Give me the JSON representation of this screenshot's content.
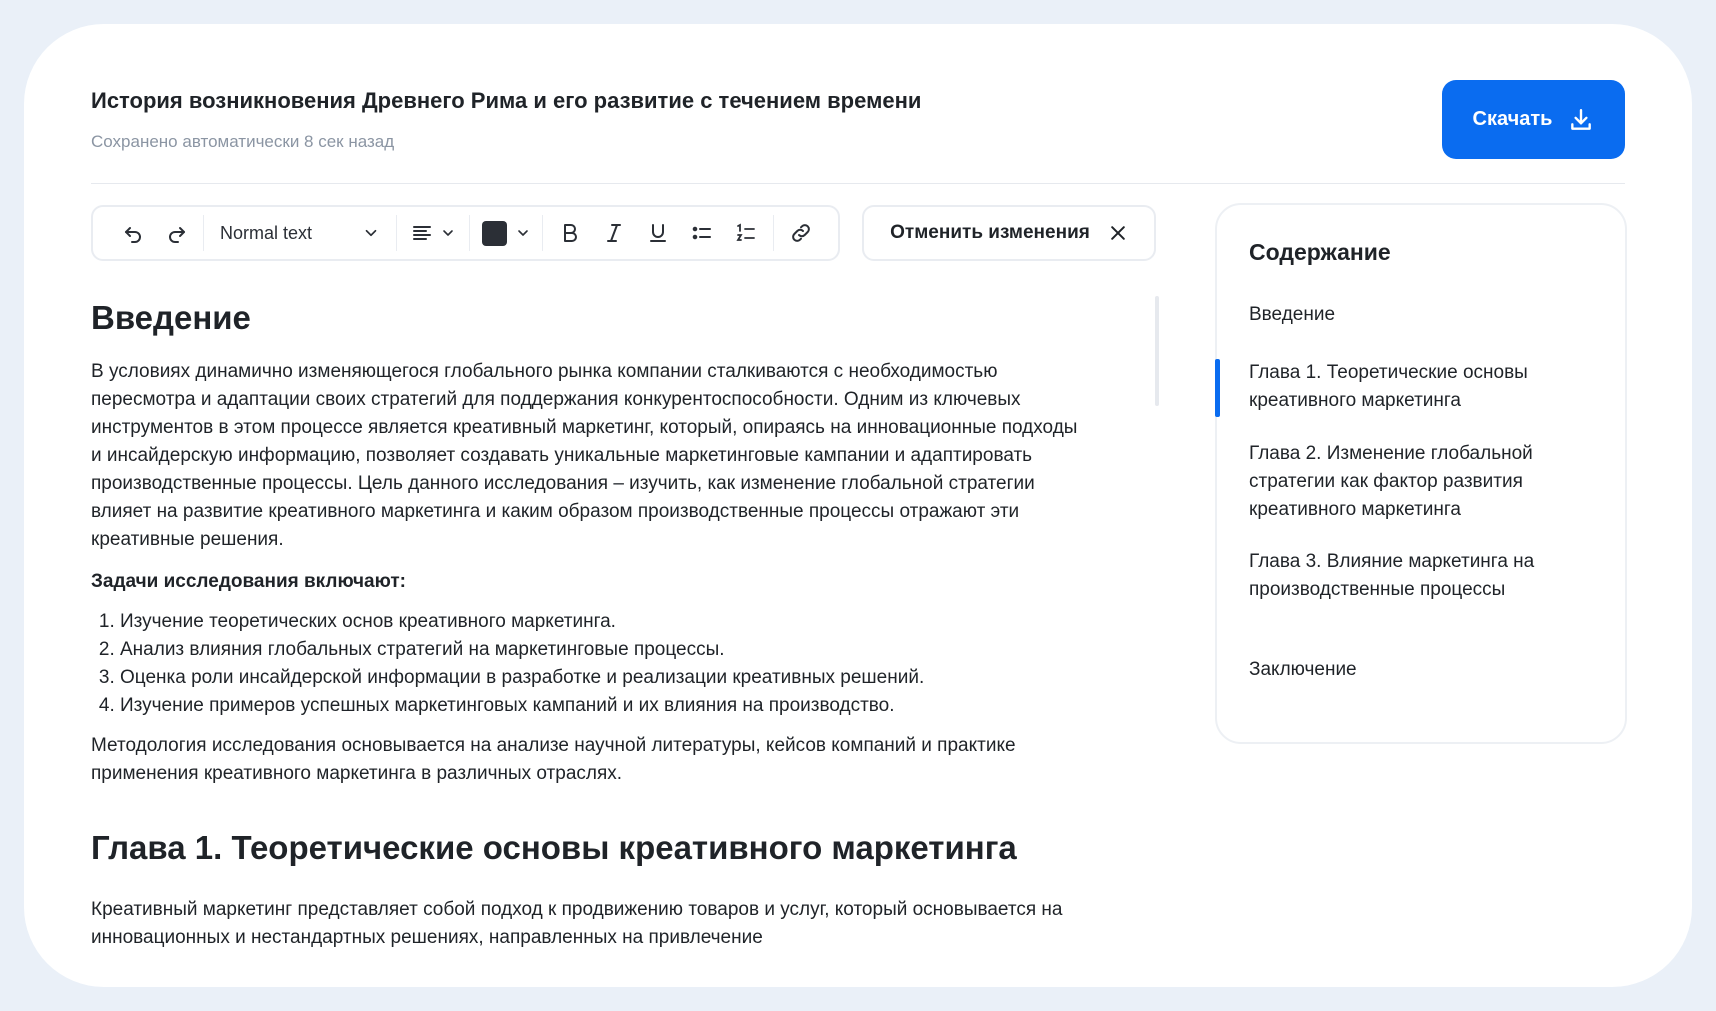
{
  "header": {
    "title": "История возникновения Древнего Рима и его развитие с течением времени",
    "saved_status": "Сохранено автоматически 8 сек назад",
    "download_label": "Скачать"
  },
  "toolbar": {
    "text_format": "Normal text",
    "text_color": "#2b2f36",
    "cancel_label": "Отменить изменения",
    "icons": [
      "undo-icon",
      "redo-icon",
      "chevron-down-icon",
      "align-left-icon",
      "bold-icon",
      "italic-icon",
      "underline-icon",
      "bullet-list-icon",
      "numbered-list-icon",
      "link-icon",
      "close-icon"
    ]
  },
  "document": {
    "intro_heading": "Введение",
    "intro_paragraph": "В условиях динамично изменяющегося глобального рынка компании сталкиваются с необходимостью пересмотра и адаптации своих стратегий для поддержания конкурентоспособности. Одним из ключевых инструментов в этом процессе является креативный маркетинг, который, опираясь на инновационные подходы и инсайдерскую информацию, позволяет создавать уникальные маркетинговые кампании и адаптировать производственные процессы. Цель данного исследования – изучить, как изменение глобальной стратегии влияет на развитие креативного маркетинга и каким образом производственные процессы отражают эти креативные решения.",
    "tasks_title": "Задачи исследования включают:",
    "tasks": [
      "Изучение теоретических основ креативного маркетинга.",
      "Анализ влияния глобальных стратегий на маркетинговые процессы.",
      "Оценка роли инсайдерской информации в разработке и реализации креативных решений.",
      "Изучение примеров успешных маркетинговых кампаний и их влияния на производство."
    ],
    "methodology": "Методология исследования основывается на анализе научной литературы, кейсов компаний и практике применения креативного маркетинга в различных отраслях.",
    "chapter1_heading": "Глава 1. Теоретические основы креативного маркетинга",
    "chapter1_paragraph": "Креативный маркетинг представляет собой подход к продвижению товаров и услуг, который основывается на инновационных и нестандартных решениях, направленных на привлечение"
  },
  "toc": {
    "title": "Содержание",
    "items": [
      "Введение",
      "Глава 1. Теоретические основы креативного маркетинга",
      "Глава 2. Изменение глобальной стратегии как фактор развития креативного маркетинга",
      "Глава 3. Влияние маркетинга на производственные процессы",
      "Заключение"
    ],
    "active_index": 1
  },
  "colors": {
    "accent": "#0a6cf0",
    "muted_text": "#8b95a3",
    "page_background": "#eaf0f8"
  }
}
